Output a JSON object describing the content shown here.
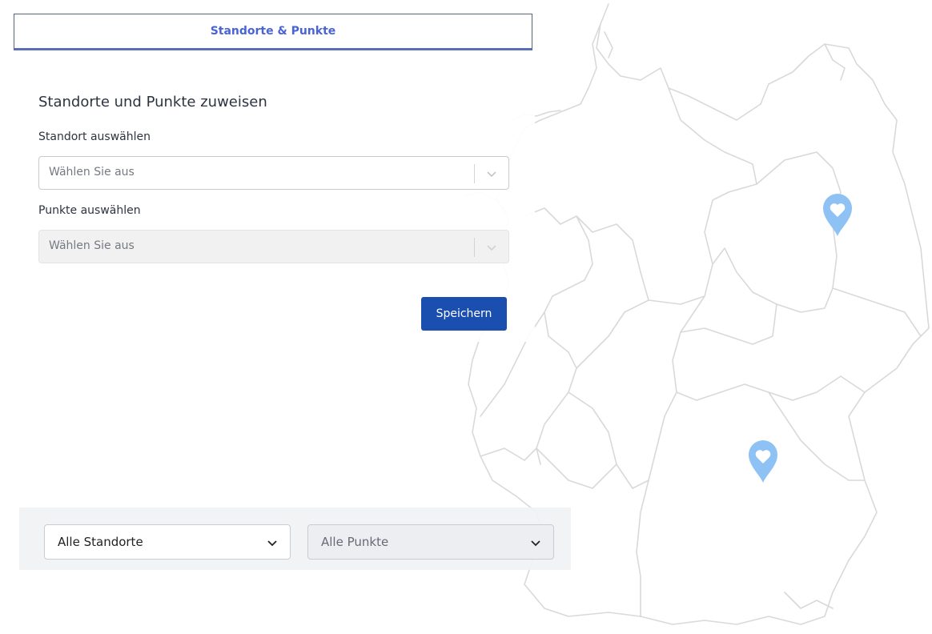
{
  "card": {
    "tab_label": "Standorte & Punkte",
    "title": "Standorte und Punkte zuweisen",
    "location_label": "Standort auswählen",
    "location_placeholder": "Wählen Sie aus",
    "points_label": "Punkte auswählen",
    "points_placeholder": "Wählen Sie aus",
    "save_label": "Speichern"
  },
  "filters": {
    "locations_value": "Alle Standorte",
    "points_value": "Alle Punkte"
  },
  "map": {
    "pin_color": "#8fc2f4",
    "outline_color": "#d9d9d9"
  },
  "colors": {
    "accent": "#4a63d6",
    "button": "#1a4fb0"
  },
  "icons": {
    "select_chevron": "chevron-down-icon",
    "map_pin": "heart-pin-icon"
  }
}
